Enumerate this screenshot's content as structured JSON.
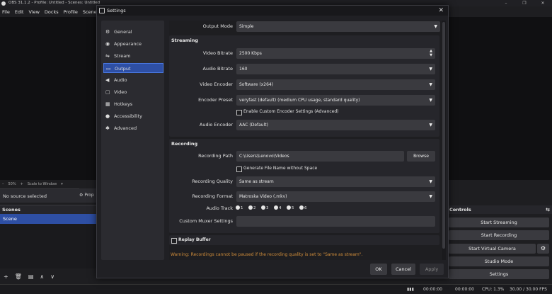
{
  "app": {
    "title": "OBS 31.1.2 - Profile: Untitled - Scenes: Untitled",
    "window_controls": [
      "–",
      "❐",
      "✕"
    ]
  },
  "menu": [
    "File",
    "Edit",
    "View",
    "Docks",
    "Profile",
    "Scene"
  ],
  "preview": {
    "zoom": "50%",
    "scale_mode": "Scale to Window"
  },
  "sources": {
    "no_source": "No source selected",
    "properties": "Prop"
  },
  "scenes": {
    "header": "Scenes",
    "items": [
      "Scene"
    ]
  },
  "controls": {
    "header": "Controls",
    "buttons": [
      "Start Streaming",
      "Start Recording",
      "Start Virtual Camera",
      "Studio Mode",
      "Settings"
    ]
  },
  "status": {
    "rec_time": "00:00:00",
    "stream_time": "00:00:00",
    "cpu": "CPU: 1.3%",
    "fps": "30.00 / 30.00 FPS"
  },
  "settings": {
    "title": "Settings",
    "nav": [
      "General",
      "Appearance",
      "Stream",
      "Output",
      "Audio",
      "Video",
      "Hotkeys",
      "Accessibility",
      "Advanced"
    ],
    "nav_selected_index": 3,
    "output_mode": {
      "label": "Output Mode",
      "value": "Simple"
    },
    "streaming": {
      "title": "Streaming",
      "video_bitrate": {
        "label": "Video Bitrate",
        "value": "2500 Kbps"
      },
      "audio_bitrate": {
        "label": "Audio Bitrate",
        "value": "160"
      },
      "video_encoder": {
        "label": "Video Encoder",
        "value": "Software (x264)"
      },
      "encoder_preset": {
        "label": "Encoder Preset",
        "value": "veryfast (default) (medium CPU usage, standard quality)"
      },
      "custom_encoder": "Enable Custom Encoder Settings (Advanced)",
      "audio_encoder": {
        "label": "Audio Encoder",
        "value": "AAC (Default)"
      }
    },
    "recording": {
      "title": "Recording",
      "path": {
        "label": "Recording Path",
        "value": "C:\\Users\\Lenovo\\Videos"
      },
      "browse": "Browse",
      "gen_filename": "Generate File Name without Space",
      "quality": {
        "label": "Recording Quality",
        "value": "Same as stream"
      },
      "format": {
        "label": "Recording Format",
        "value": "Matroska Video (.mkv)"
      },
      "audio_track": {
        "label": "Audio Track",
        "tracks": [
          "1",
          "2",
          "3",
          "4",
          "5",
          "6"
        ]
      },
      "muxer": {
        "label": "Custom Muxer Settings",
        "value": ""
      }
    },
    "replay_buffer": "Replay Buffer",
    "warning": "Warning: Recordings cannot be paused if the recording quality is set to \"Same as stream\".",
    "buttons": {
      "ok": "OK",
      "cancel": "Cancel",
      "apply": "Apply"
    }
  },
  "icons": {
    "general": "gear-icon",
    "appearance": "palette-icon",
    "stream": "antenna-icon",
    "output": "output-icon",
    "audio": "speaker-icon",
    "video": "monitor-icon",
    "hotkeys": "keyboard-icon",
    "accessibility": "accessibility-icon",
    "advanced": "wrench-icon"
  },
  "colors": {
    "accent": "#2e4fa4",
    "warning": "#d08d3a",
    "background": "#1e1e21"
  }
}
